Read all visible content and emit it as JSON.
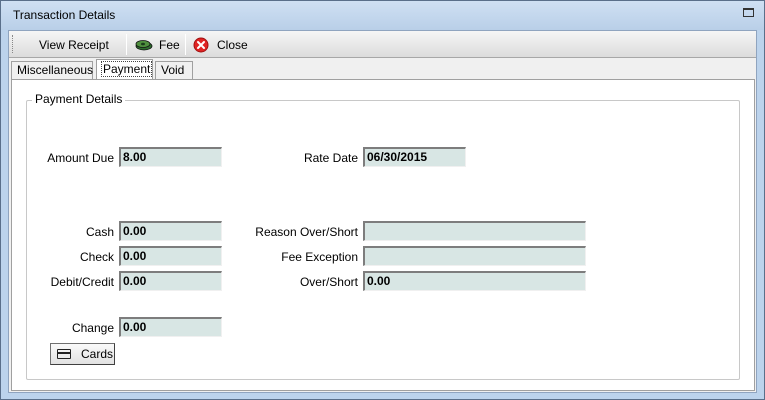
{
  "window": {
    "title": "Transaction Details"
  },
  "toolbar": {
    "view_receipt_label": "View Receipt",
    "fee_label": "Fee",
    "close_label": "Close"
  },
  "tabs": [
    {
      "label": "Miscellaneous",
      "active": false
    },
    {
      "label": "Payment",
      "active": true
    },
    {
      "label": "Void",
      "active": false
    }
  ],
  "payment_details": {
    "legend": "Payment Details",
    "amount_due": {
      "label": "Amount Due",
      "value": "8.00"
    },
    "rate_date": {
      "label": "Rate Date",
      "value": "06/30/2015"
    },
    "cash": {
      "label": "Cash",
      "value": "0.00"
    },
    "check": {
      "label": "Check",
      "value": "0.00"
    },
    "debit_credit": {
      "label": "Debit/Credit",
      "value": "0.00"
    },
    "change": {
      "label": "Change",
      "value": "0.00"
    },
    "reason_over_short": {
      "label": "Reason Over/Short",
      "value": ""
    },
    "fee_exception": {
      "label": "Fee Exception",
      "value": ""
    },
    "over_short": {
      "label": "Over/Short",
      "value": "0.00"
    }
  },
  "cards_button": {
    "label": "Cards"
  },
  "colors": {
    "field_bg": "#d8e6e4",
    "window_frame": "#bcd3ec",
    "close_icon": "#e02424"
  }
}
